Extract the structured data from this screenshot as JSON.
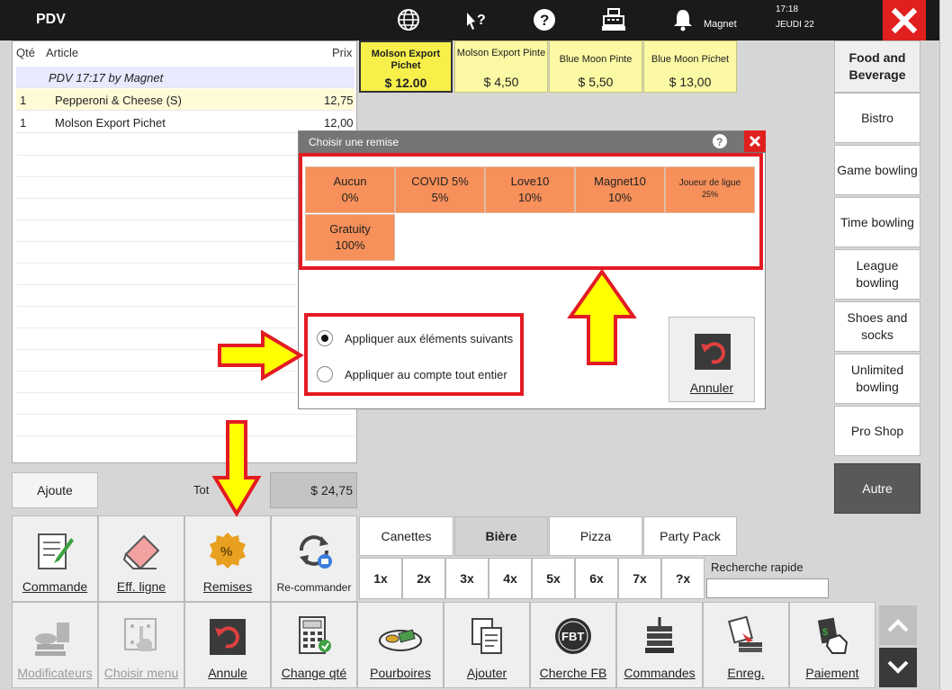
{
  "topbar": {
    "title": "PDV",
    "user": "Magnet",
    "time": "17:18",
    "date": "JEUDI 22"
  },
  "order": {
    "headers": {
      "qty": "Qté",
      "article": "Article",
      "price": "Prix"
    },
    "group_line": "PDV 17:17 by Magnet",
    "items": [
      {
        "qty": "1",
        "name": "Pepperoni & Cheese (S)",
        "price": "12,75"
      },
      {
        "qty": "1",
        "name": "Molson Export Pichet",
        "price": "12,00"
      }
    ]
  },
  "totals": {
    "ajoute_label": "Ajoute",
    "total_label": "Tot",
    "total_value": "$ 24,75"
  },
  "products": [
    {
      "name": "Molson Export Pichet",
      "price": "$ 12.00",
      "selected": true
    },
    {
      "name": "Molson Export Pinte",
      "price": "$ 4,50",
      "selected": false
    },
    {
      "name": "Blue Moon Pinte",
      "price": "$ 5,50",
      "selected": false
    },
    {
      "name": "Blue Moon Pichet",
      "price": "$ 13,00",
      "selected": false
    }
  ],
  "categories": [
    {
      "label": "Food and Beverage"
    },
    {
      "label": "Bistro"
    },
    {
      "label": "Game bowling"
    },
    {
      "label": "Time bowling"
    },
    {
      "label": "League bowling"
    },
    {
      "label": "Shoes and socks"
    },
    {
      "label": "Unlimited bowling"
    },
    {
      "label": "Pro Shop"
    },
    {
      "label": "Autre"
    }
  ],
  "tabs": [
    "Canettes",
    "Bière",
    "Pizza",
    "Party Pack"
  ],
  "quantities": [
    "1x",
    "2x",
    "3x",
    "4x",
    "5x",
    "6x",
    "7x",
    "?x"
  ],
  "quick_search": {
    "label": "Recherche rapide",
    "value": ""
  },
  "actions_row1": [
    "Commande",
    "Eff. ligne",
    "Remises",
    "Re-commander"
  ],
  "actions_row2": [
    "Modificateurs",
    "Choisir menu",
    "Annule",
    "Change qté",
    "Pourboires",
    "Ajouter",
    "Cherche FB",
    "Commandes",
    "Enreg.",
    "Paiement"
  ],
  "modal": {
    "title": "Choisir une remise",
    "discounts": [
      {
        "name": "Aucun",
        "value": "0%"
      },
      {
        "name": "COVID 5%",
        "value": "5%"
      },
      {
        "name": "Love10",
        "value": "10%"
      },
      {
        "name": "Magnet10",
        "value": "10%"
      },
      {
        "name": "Joueur de ligue",
        "value": "25%"
      },
      {
        "name": "Gratuity",
        "value": "100%"
      }
    ],
    "options": [
      {
        "label": "Appliquer aux éléments suivants",
        "checked": true
      },
      {
        "label": "Appliquer au compte tout entier",
        "checked": false
      }
    ],
    "cancel_label": "Annuler"
  },
  "colors": {
    "discount_tile": "#f7905a",
    "product_tile": "#fbf9a3",
    "highlight_box": "#e31b23",
    "arrow_fill": "#ffff00",
    "topbar": "#1a1a1a"
  }
}
